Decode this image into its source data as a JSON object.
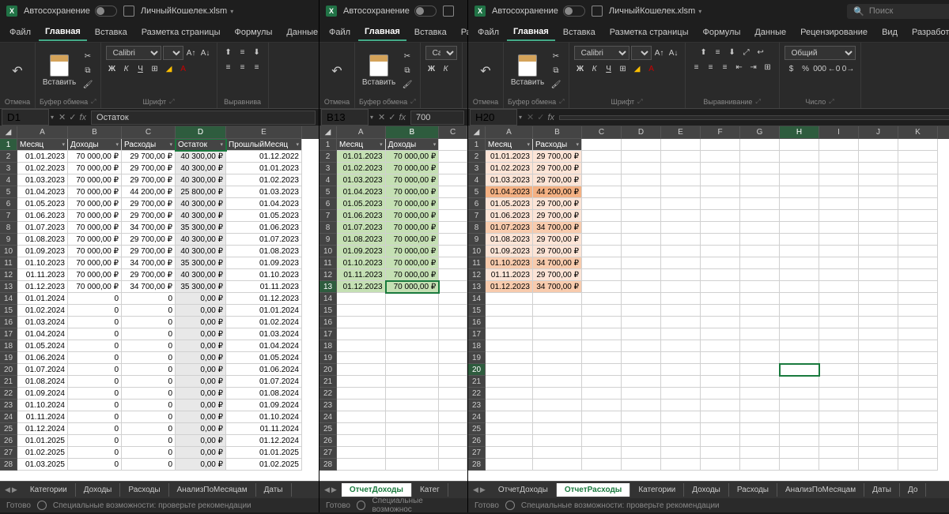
{
  "titlebar": {
    "autosave": "Автосохранение",
    "filename": "ЛичныйКошелек.xlsm",
    "search": "Поиск"
  },
  "menu": {
    "file": "Файл",
    "home": "Главная",
    "insert": "Вставка",
    "layout": "Разметка страницы",
    "formulas": "Формулы",
    "data": "Данные",
    "review_short": "Р",
    "layout_short": "Разм",
    "review": "Рецензирование",
    "view": "Вид",
    "developer": "Разработчик"
  },
  "ribbon": {
    "undo": "Отмена",
    "paste": "Вставить",
    "clipboard": "Буфер обмена",
    "font_name": "Calibri",
    "font_size": "11",
    "font": "Шрифт",
    "alignment_short": "Выравнива",
    "alignment": "Выравнивание",
    "number": "Число",
    "general": "Общий",
    "bold": "Ж",
    "italic": "К",
    "underline": "Ч"
  },
  "w1": {
    "namebox": "D1",
    "formula": "Остаток",
    "headers": [
      "Месяц",
      "Доходы",
      "Расходы",
      "Остаток",
      "ПрошлыйМесяц"
    ],
    "rows": [
      [
        "01.01.2023",
        "70 000,00 ₽",
        "29 700,00 ₽",
        "40 300,00 ₽",
        "01.12.2022"
      ],
      [
        "01.02.2023",
        "70 000,00 ₽",
        "29 700,00 ₽",
        "40 300,00 ₽",
        "01.01.2023"
      ],
      [
        "01.03.2023",
        "70 000,00 ₽",
        "29 700,00 ₽",
        "40 300,00 ₽",
        "01.02.2023"
      ],
      [
        "01.04.2023",
        "70 000,00 ₽",
        "44 200,00 ₽",
        "25 800,00 ₽",
        "01.03.2023"
      ],
      [
        "01.05.2023",
        "70 000,00 ₽",
        "29 700,00 ₽",
        "40 300,00 ₽",
        "01.04.2023"
      ],
      [
        "01.06.2023",
        "70 000,00 ₽",
        "29 700,00 ₽",
        "40 300,00 ₽",
        "01.05.2023"
      ],
      [
        "01.07.2023",
        "70 000,00 ₽",
        "34 700,00 ₽",
        "35 300,00 ₽",
        "01.06.2023"
      ],
      [
        "01.08.2023",
        "70 000,00 ₽",
        "29 700,00 ₽",
        "40 300,00 ₽",
        "01.07.2023"
      ],
      [
        "01.09.2023",
        "70 000,00 ₽",
        "29 700,00 ₽",
        "40 300,00 ₽",
        "01.08.2023"
      ],
      [
        "01.10.2023",
        "70 000,00 ₽",
        "34 700,00 ₽",
        "35 300,00 ₽",
        "01.09.2023"
      ],
      [
        "01.11.2023",
        "70 000,00 ₽",
        "29 700,00 ₽",
        "40 300,00 ₽",
        "01.10.2023"
      ],
      [
        "01.12.2023",
        "70 000,00 ₽",
        "34 700,00 ₽",
        "35 300,00 ₽",
        "01.11.2023"
      ],
      [
        "01.01.2024",
        "0",
        "0",
        "0,00 ₽",
        "01.12.2023"
      ],
      [
        "01.02.2024",
        "0",
        "0",
        "0,00 ₽",
        "01.01.2024"
      ],
      [
        "01.03.2024",
        "0",
        "0",
        "0,00 ₽",
        "01.02.2024"
      ],
      [
        "01.04.2024",
        "0",
        "0",
        "0,00 ₽",
        "01.03.2024"
      ],
      [
        "01.05.2024",
        "0",
        "0",
        "0,00 ₽",
        "01.04.2024"
      ],
      [
        "01.06.2024",
        "0",
        "0",
        "0,00 ₽",
        "01.05.2024"
      ],
      [
        "01.07.2024",
        "0",
        "0",
        "0,00 ₽",
        "01.06.2024"
      ],
      [
        "01.08.2024",
        "0",
        "0",
        "0,00 ₽",
        "01.07.2024"
      ],
      [
        "01.09.2024",
        "0",
        "0",
        "0,00 ₽",
        "01.08.2024"
      ],
      [
        "01.10.2024",
        "0",
        "0",
        "0,00 ₽",
        "01.09.2024"
      ],
      [
        "01.11.2024",
        "0",
        "0",
        "0,00 ₽",
        "01.10.2024"
      ],
      [
        "01.12.2024",
        "0",
        "0",
        "0,00 ₽",
        "01.11.2024"
      ],
      [
        "01.01.2025",
        "0",
        "0",
        "0,00 ₽",
        "01.12.2024"
      ],
      [
        "01.02.2025",
        "0",
        "0",
        "0,00 ₽",
        "01.01.2025"
      ],
      [
        "01.03.2025",
        "0",
        "0",
        "0,00 ₽",
        "01.02.2025"
      ]
    ],
    "tabs": [
      "Категории",
      "Доходы",
      "Расходы",
      "АнализПоМесяцам",
      "Даты"
    ]
  },
  "w2": {
    "namebox": "B13",
    "formula": "700",
    "headers": [
      "Месяц",
      "Доходы"
    ],
    "rows": [
      [
        "01.01.2023",
        "70 000,00 ₽"
      ],
      [
        "01.02.2023",
        "70 000,00 ₽"
      ],
      [
        "01.03.2023",
        "70 000,00 ₽"
      ],
      [
        "01.04.2023",
        "70 000,00 ₽"
      ],
      [
        "01.05.2023",
        "70 000,00 ₽"
      ],
      [
        "01.06.2023",
        "70 000,00 ₽"
      ],
      [
        "01.07.2023",
        "70 000,00 ₽"
      ],
      [
        "01.08.2023",
        "70 000,00 ₽"
      ],
      [
        "01.09.2023",
        "70 000,00 ₽"
      ],
      [
        "01.10.2023",
        "70 000,00 ₽"
      ],
      [
        "01.11.2023",
        "70 000,00 ₽"
      ],
      [
        "01.12.2023",
        "70 000,00 ₽"
      ]
    ],
    "empty_rows": [
      14,
      15,
      16,
      17,
      18,
      19,
      20,
      21,
      22,
      23,
      24,
      25,
      26,
      27,
      28
    ],
    "tabs": [
      "ОтчетДоходы",
      "Катег"
    ],
    "active_tab": "ОтчетДоходы"
  },
  "w3": {
    "namebox": "H20",
    "formula": "",
    "headers": [
      "Месяц",
      "Расходы"
    ],
    "col_letters": [
      "A",
      "B",
      "C",
      "D",
      "E",
      "F",
      "G",
      "H",
      "I",
      "J",
      "K"
    ],
    "rows": [
      {
        "d": "01.01.2023",
        "v": "29 700,00 ₽",
        "hl": "hl-orange-lt"
      },
      {
        "d": "01.02.2023",
        "v": "29 700,00 ₽",
        "hl": "hl-orange-lt"
      },
      {
        "d": "01.03.2023",
        "v": "29 700,00 ₽",
        "hl": "hl-orange-lt"
      },
      {
        "d": "01.04.2023",
        "v": "44 200,00 ₽",
        "hl": "hl-orange-dk"
      },
      {
        "d": "01.05.2023",
        "v": "29 700,00 ₽",
        "hl": "hl-orange-lt"
      },
      {
        "d": "01.06.2023",
        "v": "29 700,00 ₽",
        "hl": "hl-orange-lt"
      },
      {
        "d": "01.07.2023",
        "v": "34 700,00 ₽",
        "hl": "hl-orange"
      },
      {
        "d": "01.08.2023",
        "v": "29 700,00 ₽",
        "hl": "hl-orange-lt"
      },
      {
        "d": "01.09.2023",
        "v": "29 700,00 ₽",
        "hl": "hl-orange-lt"
      },
      {
        "d": "01.10.2023",
        "v": "34 700,00 ₽",
        "hl": "hl-orange"
      },
      {
        "d": "01.11.2023",
        "v": "29 700,00 ₽",
        "hl": "hl-orange-lt"
      },
      {
        "d": "01.12.2023",
        "v": "34 700,00 ₽",
        "hl": "hl-orange"
      }
    ],
    "empty_rows": [
      14,
      15,
      16,
      17,
      18,
      19,
      20,
      21,
      22,
      23,
      24,
      25,
      26,
      27,
      28
    ],
    "tabs": [
      "ОтчетДоходы",
      "ОтчетРасходы",
      "Категории",
      "Доходы",
      "Расходы",
      "АнализПоМесяцам",
      "Даты",
      "До"
    ],
    "active_tab": "ОтчетРасходы"
  },
  "status": {
    "ready": "Готово",
    "access": "Специальные возможности: проверьте рекомендации",
    "access_short": "Специальные возможнос"
  }
}
